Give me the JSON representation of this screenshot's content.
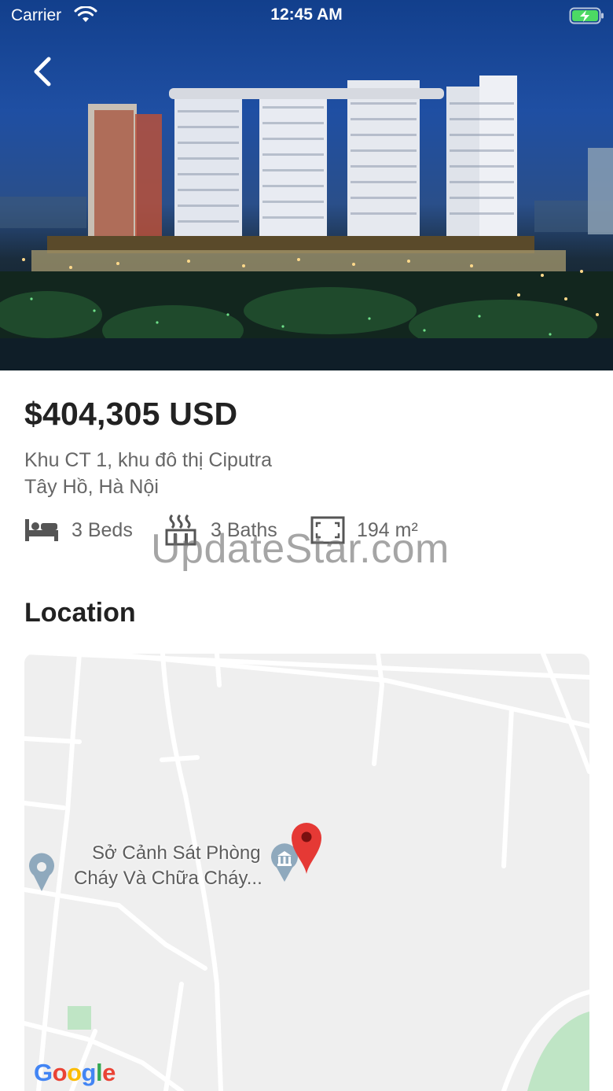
{
  "status_bar": {
    "carrier": "Carrier",
    "time": "12:45 AM",
    "battery_icon": "battery-charging-icon",
    "wifi_icon": "wifi-icon"
  },
  "hero": {
    "back_icon": "chevron-left-icon",
    "image": "apartment-towers-night-photo"
  },
  "listing": {
    "price": "$404,305 USD",
    "address_line1": "Khu CT 1, khu đô thị Ciputra",
    "address_line2": "Tây Hồ, Hà Nội",
    "features": [
      {
        "icon": "bed-icon",
        "label": "3 Beds"
      },
      {
        "icon": "bath-icon",
        "label": "3 Baths"
      },
      {
        "icon": "area-icon",
        "label": "194 m²"
      }
    ]
  },
  "watermark": "UpdateStar.com",
  "location": {
    "title": "Location",
    "map": {
      "poi_line1": "Sở Cảnh Sát Phòng",
      "poi_line2": "Cháy Và Chữa Cháy...",
      "poi_icon": "museum-pin-icon",
      "marker_icon": "red-map-pin-icon",
      "google_logo": [
        "G",
        "o",
        "o",
        "g",
        "l",
        "e"
      ],
      "google_colors": [
        "#4285F4",
        "#EA4335",
        "#FBBC05",
        "#4285F4",
        "#34A853",
        "#EA4335"
      ]
    }
  }
}
